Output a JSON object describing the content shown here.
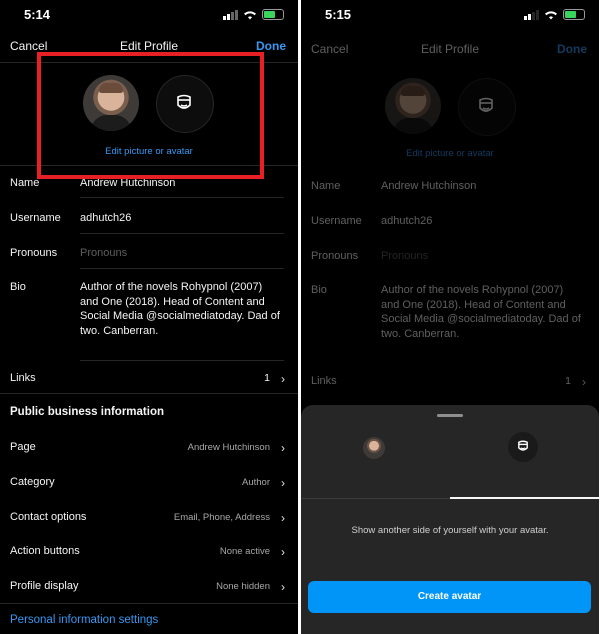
{
  "left": {
    "status": {
      "time": "5:14"
    },
    "nav": {
      "cancel": "Cancel",
      "title": "Edit Profile",
      "done": "Done"
    },
    "edit_avatar": "Edit picture or avatar",
    "fields": {
      "name": {
        "label": "Name",
        "value": "Andrew Hutchinson"
      },
      "username": {
        "label": "Username",
        "value": "adhutch26"
      },
      "pronouns": {
        "label": "Pronouns",
        "placeholder": "Pronouns"
      },
      "bio": {
        "label": "Bio",
        "value": "Author of the novels Rohypnol (2007) and One (2018). Head of Content and Social Media @socialmediatoday. Dad of two. Canberran."
      },
      "links": {
        "label": "Links",
        "value": "1"
      }
    },
    "business": {
      "heading": "Public business information",
      "items": [
        {
          "label": "Page",
          "value": "Andrew Hutchinson"
        },
        {
          "label": "Category",
          "value": "Author"
        },
        {
          "label": "Contact options",
          "value": "Email, Phone, Address"
        },
        {
          "label": "Action buttons",
          "value": "None active"
        },
        {
          "label": "Profile display",
          "value": "None hidden"
        }
      ]
    },
    "personal_settings": "Personal information settings"
  },
  "right": {
    "status": {
      "time": "5:15"
    },
    "nav": {
      "cancel": "Cancel",
      "title": "Edit Profile",
      "done": "Done"
    },
    "edit_avatar": "Edit picture or avatar",
    "fields": {
      "name": {
        "label": "Name",
        "value": "Andrew Hutchinson"
      },
      "username": {
        "label": "Username",
        "value": "adhutch26"
      },
      "pronouns": {
        "label": "Pronouns",
        "placeholder": "Pronouns"
      },
      "bio": {
        "label": "Bio",
        "value": "Author of the novels Rohypnol (2007) and One (2018). Head of Content and Social Media @socialmediatoday. Dad of two. Canberran."
      },
      "links": {
        "label": "Links",
        "value": "1"
      }
    },
    "sheet": {
      "message": "Show another side of yourself with your avatar.",
      "button": "Create avatar"
    }
  },
  "colors": {
    "accent": "#3897f0",
    "button": "#0095f6",
    "highlight": "#e81f25",
    "background": "#000000"
  },
  "icons": [
    "avatar-face-icon",
    "chevron-right-icon",
    "signal-icon",
    "wifi-icon",
    "battery-icon"
  ]
}
